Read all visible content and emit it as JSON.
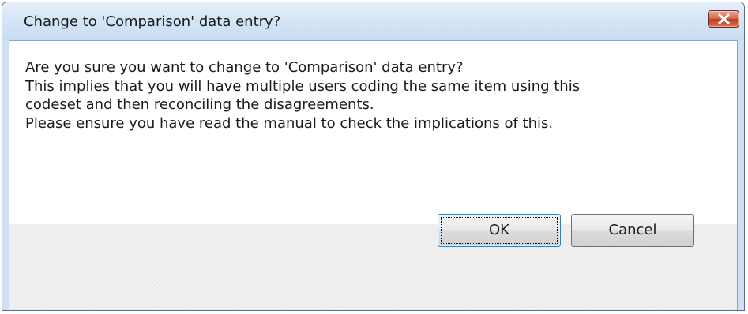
{
  "dialog": {
    "title": "Change to 'Comparison' data entry?",
    "close_icon": "close-icon",
    "message_lines": [
      "Are you sure you want to change to 'Comparison' data entry?",
      "This implies that you will have multiple users coding the same item using this",
      "codeset and then reconciling the disagreements.",
      "Please ensure you have read the manual to check the implications of this."
    ],
    "ok_label": "OK",
    "cancel_label": "Cancel"
  },
  "colors": {
    "titlebar": "#d5e5f6",
    "close_button": "#c3391d",
    "button_area": "#f0f0f0"
  }
}
